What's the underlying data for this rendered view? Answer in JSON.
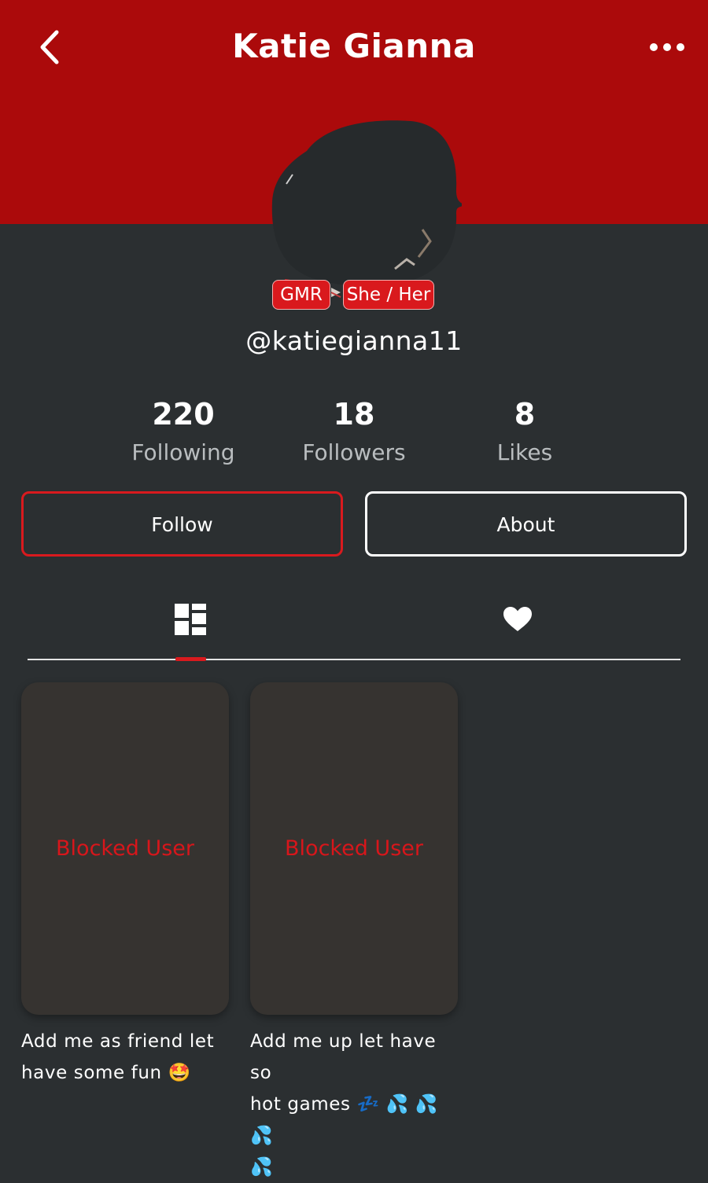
{
  "header": {
    "title": "Katie Gianna",
    "back_icon": "chevron-left-icon",
    "more_icon": "more-horizontal-icon",
    "background": "#ab0a0b"
  },
  "profile": {
    "badges": [
      "GMR",
      "She / Her"
    ],
    "username": "@katiegianna11"
  },
  "stats": [
    {
      "value": "220",
      "label": "Following"
    },
    {
      "value": "18",
      "label": "Followers"
    },
    {
      "value": "8",
      "label": "Likes"
    }
  ],
  "actions": {
    "follow_label": "Follow",
    "about_label": "About"
  },
  "tabs": [
    {
      "icon": "grid-icon",
      "active": true
    },
    {
      "icon": "heart-icon",
      "active": false
    }
  ],
  "posts": [
    {
      "overlay": "Blocked User",
      "caption_line1": "Add me as friend let",
      "caption_line2": "have some fun 🤩"
    },
    {
      "overlay": "Blocked User",
      "caption_line1": "Add me up let have so",
      "caption_line2": "hot games 💤 💦 💦 💦",
      "caption_line3": "💦"
    }
  ],
  "colors": {
    "accent": "#d91a1e",
    "background": "#2b2f31",
    "card": "#363330"
  }
}
